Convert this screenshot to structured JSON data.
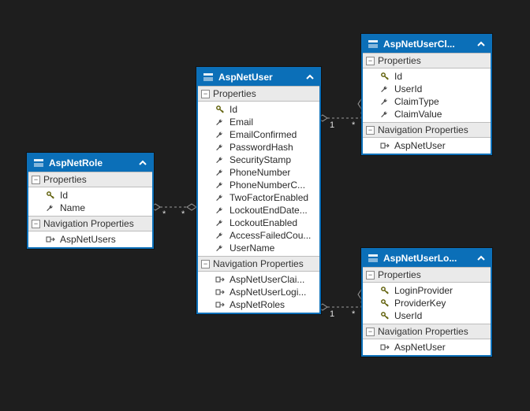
{
  "labels": {
    "properties": "Properties",
    "nav_properties": "Navigation Properties"
  },
  "icons": {
    "key": "key-icon",
    "scalar": "wrench-icon",
    "nav": "nav-prop-icon"
  },
  "colors": {
    "background": "#1e1e1e",
    "entity_header": "#0b6fb8",
    "section_header": "#eaeaea"
  },
  "connectors": [
    {
      "from": "AspNetRole",
      "to": "AspNetUser",
      "from_mult": "*",
      "to_mult": "*"
    },
    {
      "from": "AspNetUser",
      "to": "AspNetUserClaim",
      "from_mult": "1",
      "to_mult": "*"
    },
    {
      "from": "AspNetUser",
      "to": "AspNetUserLogin",
      "from_mult": "1",
      "to_mult": "*"
    }
  ],
  "entities": [
    {
      "name": "AspNetRole",
      "properties": [
        {
          "name": "Id",
          "kind": "key"
        },
        {
          "name": "Name",
          "kind": "scalar"
        }
      ],
      "navProperties": [
        {
          "name": "AspNetUsers",
          "kind": "nav"
        }
      ]
    },
    {
      "name": "AspNetUser",
      "properties": [
        {
          "name": "Id",
          "kind": "key"
        },
        {
          "name": "Email",
          "kind": "scalar"
        },
        {
          "name": "EmailConfirmed",
          "kind": "scalar"
        },
        {
          "name": "PasswordHash",
          "kind": "scalar"
        },
        {
          "name": "SecurityStamp",
          "kind": "scalar"
        },
        {
          "name": "PhoneNumber",
          "kind": "scalar"
        },
        {
          "name": "PhoneNumberC...",
          "kind": "scalar"
        },
        {
          "name": "TwoFactorEnabled",
          "kind": "scalar"
        },
        {
          "name": "LockoutEndDate...",
          "kind": "scalar"
        },
        {
          "name": "LockoutEnabled",
          "kind": "scalar"
        },
        {
          "name": "AccessFailedCou...",
          "kind": "scalar"
        },
        {
          "name": "UserName",
          "kind": "scalar"
        }
      ],
      "navProperties": [
        {
          "name": "AspNetUserClai...",
          "kind": "nav"
        },
        {
          "name": "AspNetUserLogi...",
          "kind": "nav"
        },
        {
          "name": "AspNetRoles",
          "kind": "nav"
        }
      ]
    },
    {
      "name": "AspNetUserCl...",
      "properties": [
        {
          "name": "Id",
          "kind": "key"
        },
        {
          "name": "UserId",
          "kind": "scalar"
        },
        {
          "name": "ClaimType",
          "kind": "scalar"
        },
        {
          "name": "ClaimValue",
          "kind": "scalar"
        }
      ],
      "navProperties": [
        {
          "name": "AspNetUser",
          "kind": "nav"
        }
      ]
    },
    {
      "name": "AspNetUserLo...",
      "properties": [
        {
          "name": "LoginProvider",
          "kind": "key"
        },
        {
          "name": "ProviderKey",
          "kind": "key"
        },
        {
          "name": "UserId",
          "kind": "key"
        },
        {
          "name": "UserId",
          "kind": "scalar",
          "hidden": true
        }
      ],
      "navProperties": [
        {
          "name": "AspNetUser",
          "kind": "nav"
        }
      ]
    }
  ]
}
